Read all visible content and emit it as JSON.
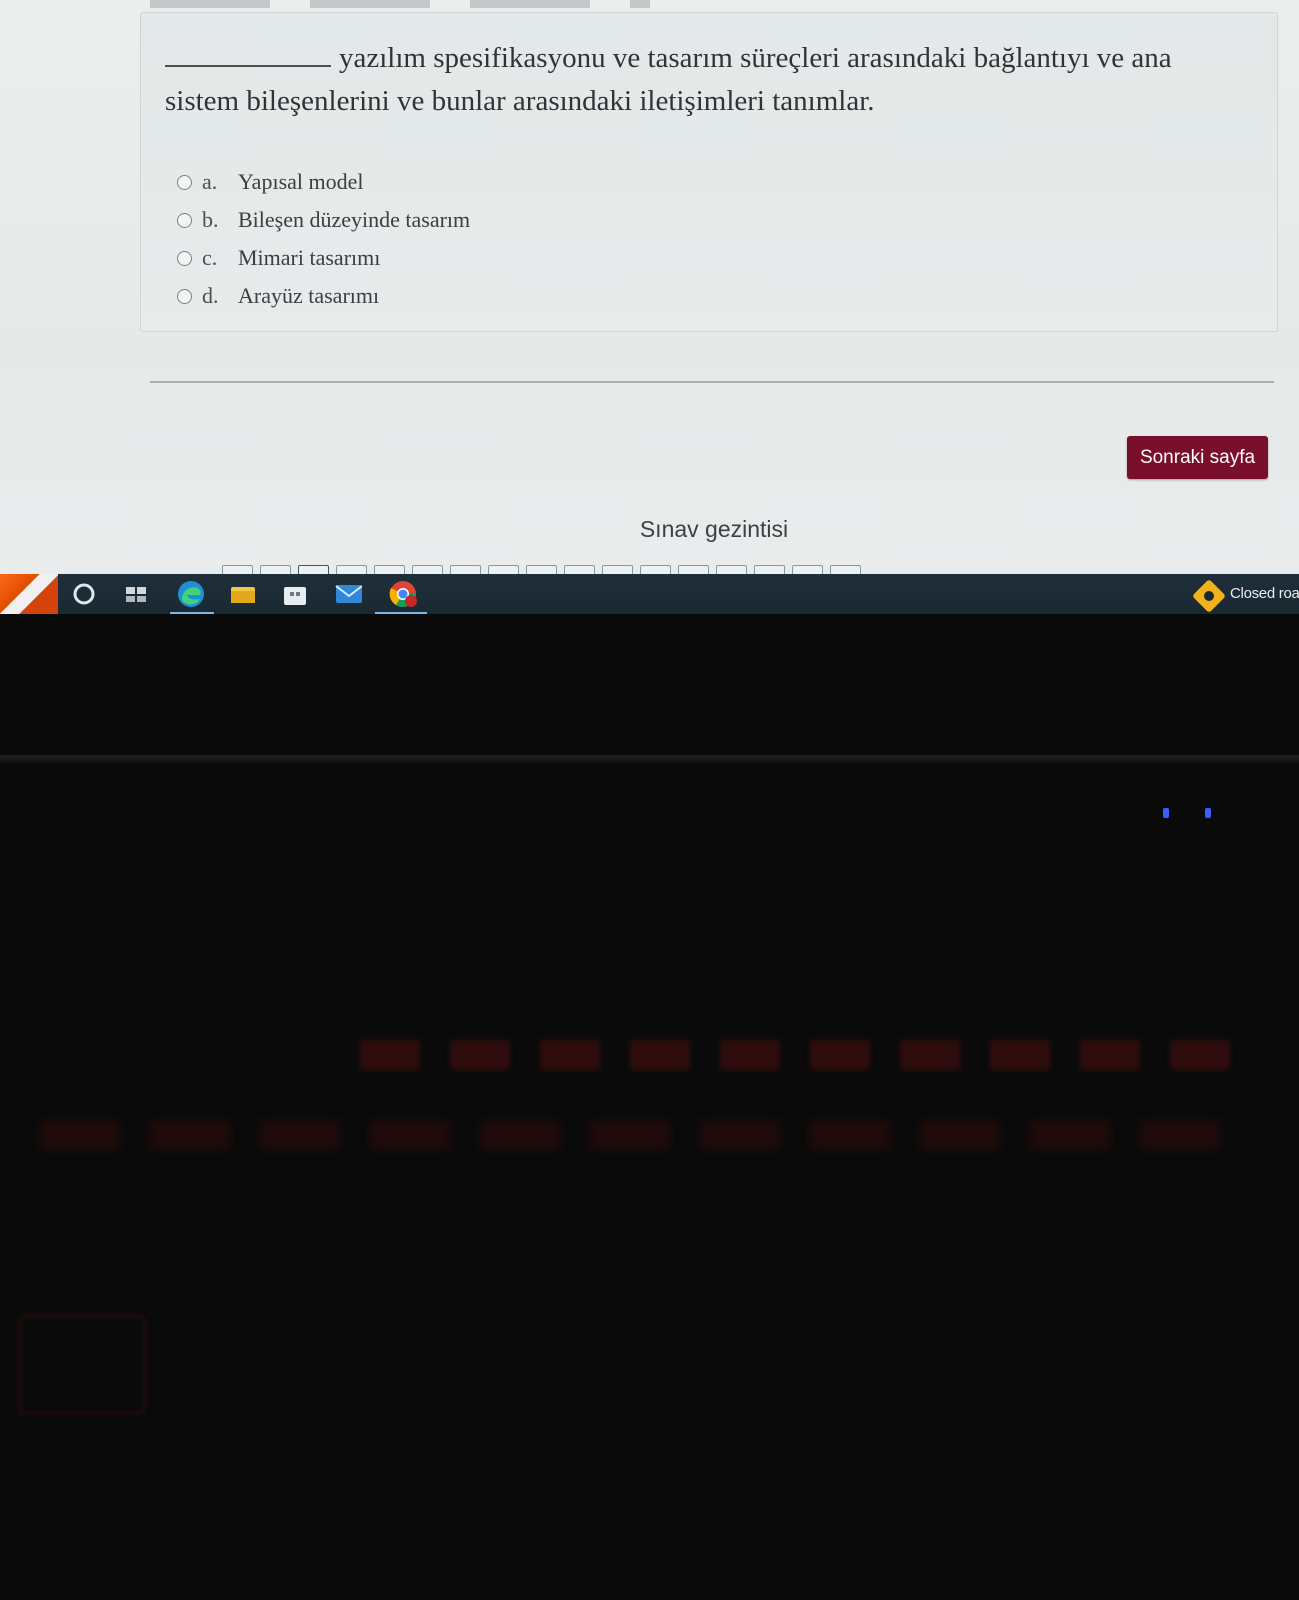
{
  "question": {
    "text": "yazılım spesifikasyonu ve tasarım süreçleri arasındaki bağlantıyı ve ana sistem bileşenlerini ve bunlar arasındaki iletişimleri tanımlar.",
    "answers": [
      {
        "letter": "a.",
        "label": "Yapısal model"
      },
      {
        "letter": "b.",
        "label": "Bileşen düzeyinde tasarım"
      },
      {
        "letter": "c.",
        "label": "Mimari tasarımı"
      },
      {
        "letter": "d.",
        "label": "Arayüz tasarımı"
      }
    ]
  },
  "next_button": {
    "label": "Sonraki sayfa"
  },
  "quiz_navigation": {
    "title": "Sınav gezintisi"
  },
  "taskbar": {
    "icons": [
      "start-icon",
      "cortana-icon",
      "task-view-icon",
      "edge-icon",
      "file-explorer-icon",
      "store-icon",
      "mail-icon",
      "chrome-icon"
    ],
    "notification": {
      "text": "Closed roa",
      "icon": "warning-diamond-icon"
    }
  },
  "colors": {
    "accent": "#7a0f2c",
    "taskbar": "#1a2832",
    "notification": "#f2b21c"
  }
}
